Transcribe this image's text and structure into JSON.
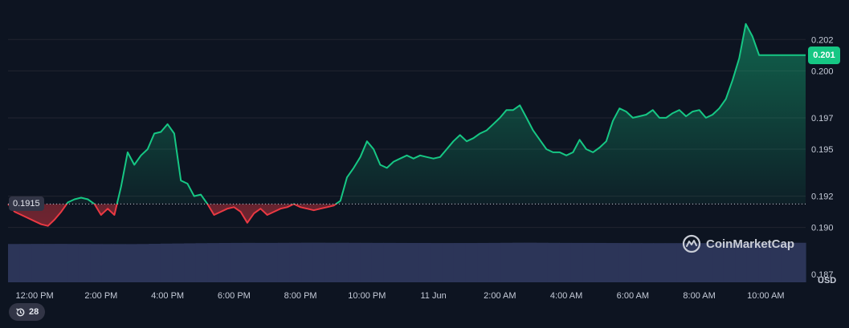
{
  "chart_data": {
    "type": "line",
    "xlabel": "",
    "ylabel": "",
    "unit": "USD",
    "x_ticks": [
      "12:00 PM",
      "2:00 PM",
      "4:00 PM",
      "6:00 PM",
      "8:00 PM",
      "10:00 PM",
      "11 Jun",
      "2:00 AM",
      "4:00 AM",
      "6:00 AM",
      "8:00 AM",
      "10:00 AM"
    ],
    "y_ticks": [
      "0.187",
      "0.190",
      "0.192",
      "0.195",
      "0.197",
      "0.200",
      "0.202"
    ],
    "ylim": [
      0.1865,
      0.2035
    ],
    "x_range_hours": [
      -0.8,
      23.2
    ],
    "reference_price": 0.1915,
    "reference_label": "0.1915",
    "current_price": 0.201,
    "current_label": "0.201",
    "up_color": "#16c784",
    "down_color": "#ea3943",
    "grid": true,
    "series": [
      {
        "x": [
          -0.8,
          -0.6,
          -0.4,
          -0.2,
          0.0,
          0.2,
          0.4,
          0.6,
          0.8,
          1.0,
          1.2,
          1.4,
          1.6,
          1.8,
          2.0,
          2.2,
          2.4,
          2.6,
          2.8,
          3.0,
          3.2,
          3.4,
          3.6,
          3.8,
          4.0,
          4.2,
          4.4,
          4.6,
          4.8,
          5.0,
          5.2,
          5.4,
          5.6,
          5.8,
          6.0,
          6.2,
          6.4,
          6.6,
          6.8,
          7.0,
          7.2,
          7.4,
          7.6,
          7.8,
          8.0,
          8.2,
          8.4,
          8.6,
          8.8,
          9.0,
          9.2,
          9.4,
          9.6,
          9.8,
          10.0,
          10.2,
          10.4,
          10.6,
          10.8,
          11.0,
          11.2,
          11.4,
          11.6,
          11.8,
          12.0,
          12.2,
          12.4,
          12.6,
          12.8,
          13.0,
          13.2,
          13.4,
          13.6,
          13.8,
          14.0,
          14.2,
          14.4,
          14.6,
          14.8,
          15.0,
          15.2,
          15.4,
          15.6,
          15.8,
          16.0,
          16.2,
          16.4,
          16.6,
          16.8,
          17.0,
          17.2,
          17.4,
          17.6,
          17.8,
          18.0,
          18.2,
          18.4,
          18.6,
          18.8,
          19.0,
          19.2,
          19.4,
          19.6,
          19.8,
          20.0,
          20.2,
          20.4,
          20.6,
          20.8,
          21.0,
          21.2,
          21.4,
          21.6,
          21.8,
          22.0,
          22.2,
          22.4,
          22.6,
          22.8,
          23.0,
          23.2
        ],
        "values": [
          0.1915,
          0.191,
          0.1908,
          0.1906,
          0.1904,
          0.1902,
          0.1901,
          0.1905,
          0.191,
          0.1916,
          0.1918,
          0.1919,
          0.1918,
          0.1915,
          0.1908,
          0.1912,
          0.1908,
          0.1926,
          0.1948,
          0.194,
          0.1946,
          0.195,
          0.196,
          0.1961,
          0.1966,
          0.196,
          0.193,
          0.1928,
          0.192,
          0.1921,
          0.1915,
          0.1908,
          0.191,
          0.1912,
          0.1913,
          0.191,
          0.1903,
          0.1909,
          0.1912,
          0.1908,
          0.191,
          0.1912,
          0.1913,
          0.1915,
          0.1913,
          0.1912,
          0.1911,
          0.1912,
          0.1913,
          0.1914,
          0.1917,
          0.1932,
          0.1938,
          0.1945,
          0.1955,
          0.195,
          0.194,
          0.1938,
          0.1942,
          0.1944,
          0.1946,
          0.1944,
          0.1946,
          0.1945,
          0.1944,
          0.1945,
          0.195,
          0.1955,
          0.1959,
          0.1955,
          0.1957,
          0.196,
          0.1962,
          0.1966,
          0.197,
          0.1975,
          0.1975,
          0.1978,
          0.197,
          0.1962,
          0.1956,
          0.195,
          0.1948,
          0.1948,
          0.1946,
          0.1948,
          0.1956,
          0.195,
          0.1948,
          0.1951,
          0.1955,
          0.1968,
          0.1976,
          0.1974,
          0.197,
          0.1971,
          0.1972,
          0.1975,
          0.197,
          0.197,
          0.1973,
          0.1975,
          0.1971,
          0.1974,
          0.1975,
          0.197,
          0.1972,
          0.1976,
          0.1982,
          0.1994,
          0.2008,
          0.203,
          0.2022,
          0.201,
          0.201,
          0.201,
          0.201,
          0.201,
          0.201,
          0.201,
          0.201
        ]
      },
      {
        "name": "",
        "values": [
          0.0124,
          0.01241,
          0.01243,
          0.01243,
          0.01244,
          0.01242,
          0.0124,
          0.01239,
          0.01238,
          0.01238,
          0.01237,
          0.0124,
          0.01246,
          0.01253,
          0.01257,
          0.01262,
          0.01266,
          0.0127,
          0.01273,
          0.01276,
          0.01277,
          0.01276,
          0.01276,
          0.01278,
          0.0128,
          0.01282,
          0.01282,
          0.01281,
          0.01281,
          0.01278,
          0.01277,
          0.01276,
          0.01276,
          0.01274,
          0.01273,
          0.01273,
          0.01271,
          0.01271,
          0.01272,
          0.01272,
          0.01274,
          0.01276,
          0.01279,
          0.01282,
          0.01283,
          0.0128,
          0.01277,
          0.01276,
          0.01275,
          0.01275,
          0.01274,
          0.01272,
          0.01271,
          0.01269,
          0.01268,
          0.01268,
          0.01268,
          0.01268,
          0.01268,
          0.01268,
          0.0127,
          0.01274,
          0.01275,
          0.01276,
          0.01278,
          0.01279,
          0.01279,
          0.0128
        ]
      }
    ]
  },
  "branding": {
    "name": "CoinMarketCap"
  },
  "history": {
    "count": "28",
    "icon": "history-icon"
  }
}
